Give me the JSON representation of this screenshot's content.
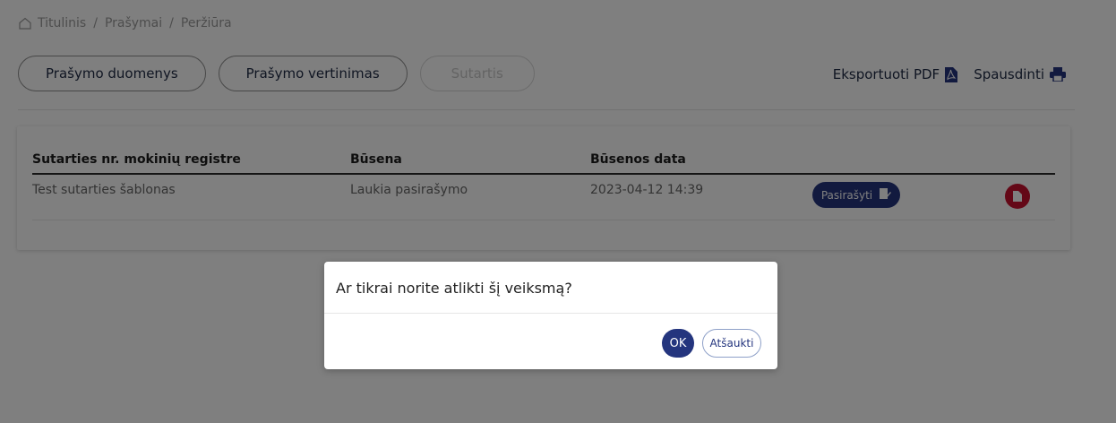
{
  "breadcrumb": {
    "items": [
      "Titulinis",
      "Prašymai",
      "Peržiūra"
    ],
    "separator": "/"
  },
  "tabs": [
    {
      "label": "Prašymo duomenys",
      "enabled": true
    },
    {
      "label": "Prašymo vertinimas",
      "enabled": true
    },
    {
      "label": "Sutartis",
      "enabled": false
    }
  ],
  "actions": {
    "export_label": "Eksportuoti PDF",
    "export_icon": "pdf-icon",
    "print_label": "Spausdinti",
    "print_icon": "printer-icon"
  },
  "table": {
    "headers": [
      "Sutarties nr. mokinių registre",
      "Būsena",
      "Būsenos data"
    ],
    "rows": [
      {
        "name": "Test sutarties šablonas",
        "status": "Laukia pasirašymo",
        "date": "2023-04-12 14:39",
        "sign_label": "Pasirašyti",
        "sign_icon": "signature-icon",
        "doc_icon": "document-icon"
      }
    ]
  },
  "modal": {
    "message": "Ar tikrai norite atlikti šį veiksmą?",
    "ok_label": "OK",
    "cancel_label": "Atšaukti"
  },
  "colors": {
    "primary": "#24357e",
    "danger": "#c8102e",
    "overlay": "rgba(0,0,0,0.5)"
  }
}
